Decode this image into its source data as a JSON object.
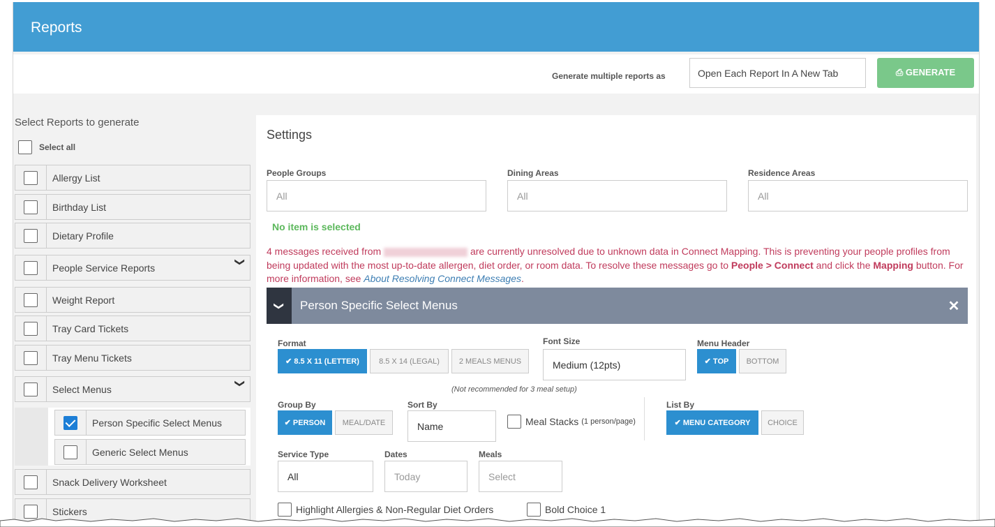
{
  "header": {
    "title": "Reports"
  },
  "generate": {
    "label": "Generate multiple reports as",
    "option": "Open Each Report In A New Tab",
    "button": "GENERATE",
    "button_color": "#7ac88a"
  },
  "left": {
    "title": "Select Reports to generate",
    "select_all": "Select all",
    "items": [
      {
        "label": "Allergy List",
        "checked": false
      },
      {
        "label": "Birthday List",
        "checked": false
      },
      {
        "label": "Dietary Profile",
        "checked": false
      },
      {
        "label": "People Service Reports",
        "checked": false,
        "expandable": true
      },
      {
        "label": "Weight Report",
        "checked": false
      },
      {
        "label": "Tray Card Tickets",
        "checked": false
      },
      {
        "label": "Tray Menu Tickets",
        "checked": false
      },
      {
        "label": "Select Menus",
        "checked": false,
        "expandable": true
      },
      {
        "label": "Snack Delivery Worksheet",
        "checked": false
      },
      {
        "label": "Stickers",
        "checked": false
      }
    ],
    "sub_items": [
      {
        "label": "Person Specific Select Menus",
        "checked": true
      },
      {
        "label": "Generic Select Menus",
        "checked": false
      }
    ]
  },
  "settings": {
    "title": "Settings",
    "people_groups": {
      "label": "People Groups",
      "value": "All"
    },
    "dining_areas": {
      "label": "Dining Areas",
      "value": "All"
    },
    "residence_areas": {
      "label": "Residence Areas",
      "value": "All"
    },
    "no_item": "No item is selected",
    "message": {
      "p1": "4 messages received from",
      "p2": "are currently unresolved due to unknown data in Connect Mapping. This is preventing your people profiles from being updated with the most up-to-date allergen, diet order, or room data. To resolve these messages go to",
      "people_connect": "People > Connect",
      "p3": "and click the",
      "mapping": "Mapping",
      "p4": "button. For more information, see",
      "link": "About Resolving Connect Messages",
      "p5": "."
    }
  },
  "panel": {
    "title": "Person Specific Select Menus",
    "format": {
      "label": "Format",
      "options": [
        "8.5 X 11 (LETTER)",
        "8.5 X 14 (LEGAL)",
        "2 MEALS MENUS"
      ],
      "selected": "8.5 X 11 (LETTER)"
    },
    "format_note": "(Not recommended for 3 meal setup)",
    "font_size": {
      "label": "Font Size",
      "value": "Medium (12pts)"
    },
    "menu_header": {
      "label": "Menu Header",
      "options": [
        "TOP",
        "BOTTOM"
      ],
      "selected": "TOP"
    },
    "group_by": {
      "label": "Group By",
      "options": [
        "PERSON",
        "MEAL/DATE"
      ],
      "selected": "PERSON"
    },
    "sort_by": {
      "label": "Sort By",
      "value": "Name"
    },
    "meal_stacks": {
      "label": "Meal Stacks",
      "sub": "(1 person/page)"
    },
    "list_by": {
      "label": "List By",
      "options": [
        "MENU CATEGORY",
        "CHOICE"
      ],
      "selected": "MENU CATEGORY"
    },
    "service_type": {
      "label": "Service Type",
      "value": "All"
    },
    "dates": {
      "label": "Dates",
      "value": "Today"
    },
    "meals": {
      "label": "Meals",
      "value": "Select"
    },
    "highlight": "Highlight Allergies & Non-Regular Diet Orders",
    "bold_choice": "Bold Choice 1"
  },
  "colors": {
    "header_blue": "#429dd3",
    "panel_gray": "#7e8a9d",
    "toggle_on": "#2c8fd0",
    "message_red": "#c03b5c"
  }
}
